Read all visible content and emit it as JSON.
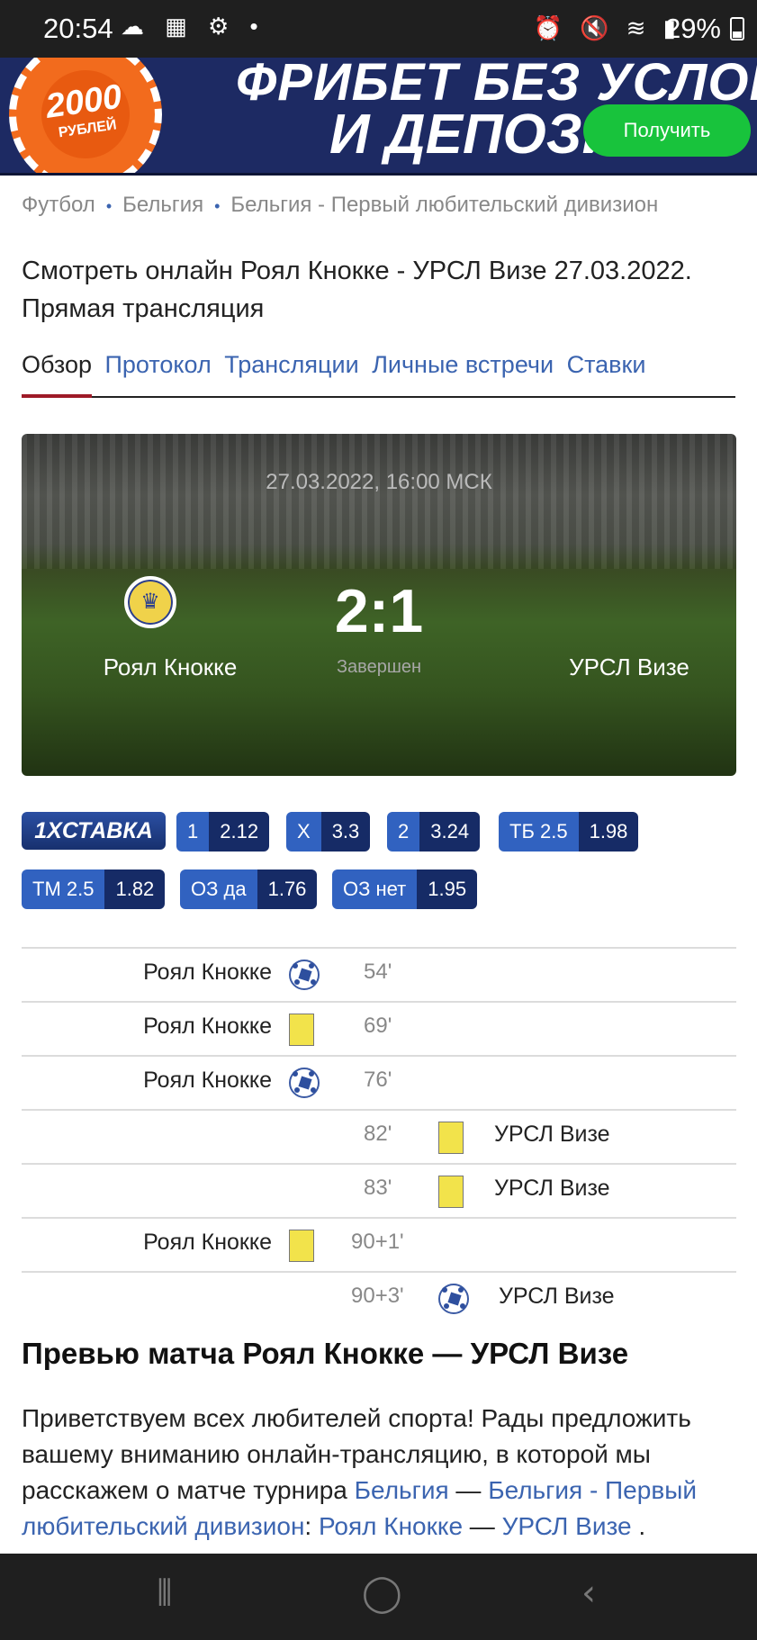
{
  "status_bar": {
    "time": "20:54",
    "left_icons": "☁ ▦ ⚙ •",
    "right_icons": "⏰ 🔇 ≋ ▮",
    "battery": "29%"
  },
  "ad_banner": {
    "chip_amount": "2000",
    "chip_currency": "РУБЛЕЙ",
    "title_line1": "ФРИБЕТ БЕЗ УСЛОВИЙ",
    "title_line2": "И ДЕПОЗИТА",
    "button_label": "Получить"
  },
  "breadcrumb": {
    "items": [
      "Футбол",
      "Бельгия",
      "Бельгия - Первый любительский дивизион"
    ],
    "separator": "•"
  },
  "page_title": "Смотреть онлайн Роял Кнокке - УРСЛ Визе 27.03.2022. Прямая трансляция",
  "tabs": {
    "active": "Обзор",
    "items": [
      "Протокол",
      "Трансляции",
      "Личные встречи",
      "Ставки"
    ]
  },
  "match": {
    "datetime": "27.03.2022, 16:00 МСК",
    "home_team": "Роял Кнокке",
    "away_team": "УРСЛ Визе",
    "score": "2:1",
    "status": "Завершен"
  },
  "odds": {
    "bookmaker": "1XСТАВКА",
    "items": [
      {
        "label": "1",
        "value": "2.12"
      },
      {
        "label": "X",
        "value": "3.3"
      },
      {
        "label": "2",
        "value": "3.24"
      },
      {
        "label": "ТБ 2.5",
        "value": "1.98"
      },
      {
        "label": "ТМ 2.5",
        "value": "1.82"
      },
      {
        "label": "ОЗ да",
        "value": "1.76"
      },
      {
        "label": "ОЗ нет",
        "value": "1.95"
      }
    ]
  },
  "events": [
    {
      "side": "home",
      "team": "Роял Кнокке",
      "type": "goal",
      "minute": "54'"
    },
    {
      "side": "home",
      "team": "Роял Кнокке",
      "type": "yellow-card",
      "minute": "69'"
    },
    {
      "side": "home",
      "team": "Роял Кнокке",
      "type": "goal",
      "minute": "76'"
    },
    {
      "side": "away",
      "team": "УРСЛ Визе",
      "type": "yellow-card",
      "minute": "82'"
    },
    {
      "side": "away",
      "team": "УРСЛ Визе",
      "type": "yellow-card",
      "minute": "83'"
    },
    {
      "side": "home",
      "team": "Роял Кнокке",
      "type": "yellow-card",
      "minute": "90+1'"
    },
    {
      "side": "away",
      "team": "УРСЛ Визе",
      "type": "goal",
      "minute": "90+3'"
    }
  ],
  "preview": {
    "title": "Превью матча Роял Кнокке — УРСЛ Визе",
    "text_intro": "Приветствуем всех любителей спорта! Рады предложить вашему вниманию онлайн-трансляцию, в которой мы расскажем о матче турнира ",
    "link_country": "Бельгия",
    "dash": " — ",
    "link_league": "Бельгия - Первый любительский дивизион",
    "colon": ": ",
    "link_home": "Роял Кнокке",
    "link_away": "УРСЛ Визе",
    "end": " ."
  },
  "nav_bar": {
    "recents": "⦀",
    "home": "◯",
    "back": "‹"
  }
}
